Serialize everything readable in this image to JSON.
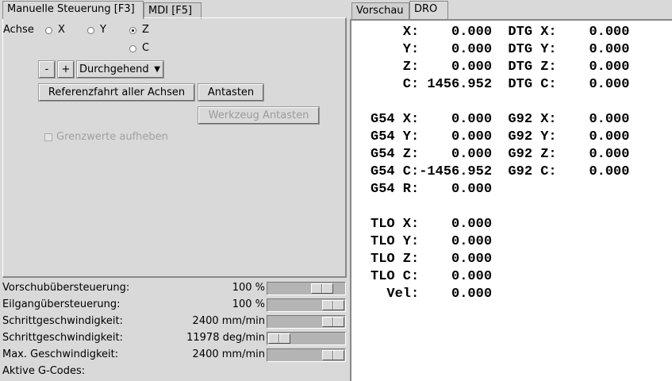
{
  "left_tabs": [
    {
      "label": "Manuelle Steuerung [F3]",
      "active": true
    },
    {
      "label": "MDI [F5]",
      "active": false
    }
  ],
  "right_tabs": [
    {
      "label": "Vorschau",
      "active": false
    },
    {
      "label": "DRO",
      "active": true
    }
  ],
  "manual": {
    "axis_label": "Achse",
    "axes": [
      {
        "label": "X",
        "checked": false
      },
      {
        "label": "Y",
        "checked": false
      },
      {
        "label": "Z",
        "checked": true
      },
      {
        "label": "C",
        "checked": false
      }
    ],
    "minus_label": "-",
    "plus_label": "+",
    "jog_mode": "Durchgehend",
    "home_all_label": "Referenzfahrt aller Achsen",
    "probe_label": "Antasten",
    "tool_probe_label": "Werkzeug Antasten",
    "override_limits_label": "Grenzwerte aufheben"
  },
  "status_rows": [
    {
      "label": "Vorschubübersteuerung:",
      "value": "100 %",
      "slider_level": 0.8
    },
    {
      "label": "Eilgangübersteuerung:",
      "value": "100 %",
      "slider_level": 1.0
    },
    {
      "label": "Schrittgeschwindigkeit:",
      "value": "2400 mm/min",
      "slider_level": 1.0
    },
    {
      "label": "Schrittgeschwindigkeit:",
      "value": "11978 deg/min",
      "slider_level": 0.0
    },
    {
      "label": "Max. Geschwindigkeit:",
      "value": "2400 mm/min",
      "slider_level": 1.0
    }
  ],
  "active_gcodes_label": "Aktive G-Codes:",
  "dro_lines": [
    "    X:    0.000  DTG X:    0.000",
    "    Y:    0.000  DTG Y:    0.000",
    "    Z:    0.000  DTG Z:    0.000",
    "    C: 1456.952  DTG C:    0.000",
    "",
    "G54 X:    0.000  G92 X:    0.000",
    "G54 Y:    0.000  G92 Y:    0.000",
    "G54 Z:    0.000  G92 Z:    0.000",
    "G54 C:-1456.952  G92 C:    0.000",
    "G54 R:    0.000",
    "",
    "TLO X:    0.000",
    "TLO Y:    0.000",
    "TLO Z:    0.000",
    "TLO C:    0.000",
    "  Vel:    0.000"
  ]
}
